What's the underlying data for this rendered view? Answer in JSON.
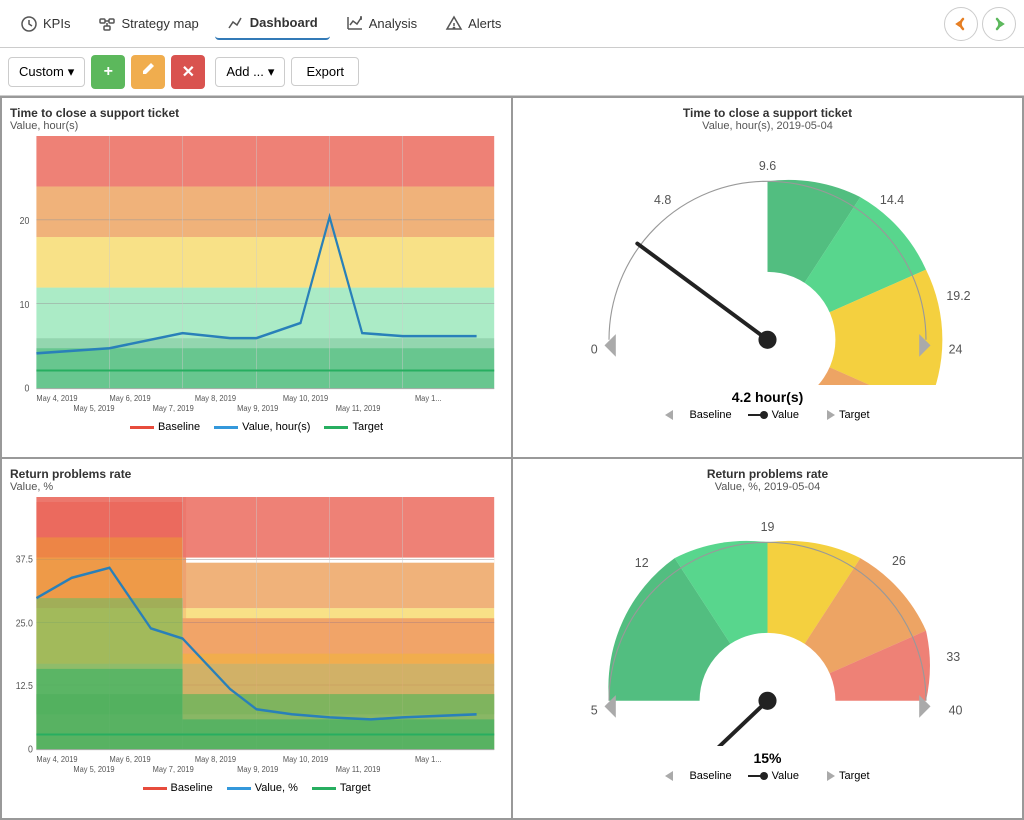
{
  "navbar": {
    "items": [
      {
        "label": "KPIs",
        "icon": "kpi-icon"
      },
      {
        "label": "Strategy map",
        "icon": "strategy-icon"
      },
      {
        "label": "Dashboard",
        "icon": "dashboard-icon"
      },
      {
        "label": "Analysis",
        "icon": "analysis-icon"
      },
      {
        "label": "Alerts",
        "icon": "alerts-icon"
      }
    ],
    "back_label": "←",
    "forward_label": "→"
  },
  "toolbar": {
    "custom_label": "Custom",
    "add_label": "Add ...",
    "export_label": "Export",
    "dropdown_arrow": "▾"
  },
  "panels": {
    "top_left": {
      "title": "Time to close a support ticket",
      "subtitle": "Value, hour(s)",
      "legend": [
        "Baseline",
        "Value, hour(s)",
        "Target"
      ],
      "x_labels": [
        "May 4, 2019",
        "May 5, 2019",
        "May 6, 2019",
        "May 7, 2019",
        "May 8, 2019",
        "May 9, 2019",
        "May 10, 2019",
        "May 11, 2019",
        "May 1..."
      ],
      "y_labels": [
        "0",
        "10",
        "20"
      ]
    },
    "top_right": {
      "title": "Time to close a support ticket",
      "subtitle": "Value, hour(s), 2019-05-04",
      "value": "4.2 hour(s)",
      "gauge_labels": [
        "0",
        "4.8",
        "9.6",
        "14.4",
        "19.2",
        "24"
      ],
      "legend": [
        "Baseline",
        "Value",
        "Target"
      ]
    },
    "bottom_left": {
      "title": "Return problems rate",
      "subtitle": "Value, %",
      "legend": [
        "Baseline",
        "Value, %",
        "Target"
      ],
      "x_labels": [
        "May 4, 2019",
        "May 5, 2019",
        "May 6, 2019",
        "May 7, 2019",
        "May 8, 2019",
        "May 9, 2019",
        "May 10, 2019",
        "May 11, 2019",
        "May 1..."
      ],
      "y_labels": [
        "0",
        "12.5",
        "25.0",
        "37.5"
      ]
    },
    "bottom_right": {
      "title": "Return problems rate",
      "subtitle": "Value, %, 2019-05-04",
      "value": "15%",
      "gauge_labels": [
        "5",
        "12",
        "19",
        "26",
        "33",
        "40"
      ],
      "legend": [
        "Baseline",
        "Value",
        "Target"
      ]
    }
  }
}
